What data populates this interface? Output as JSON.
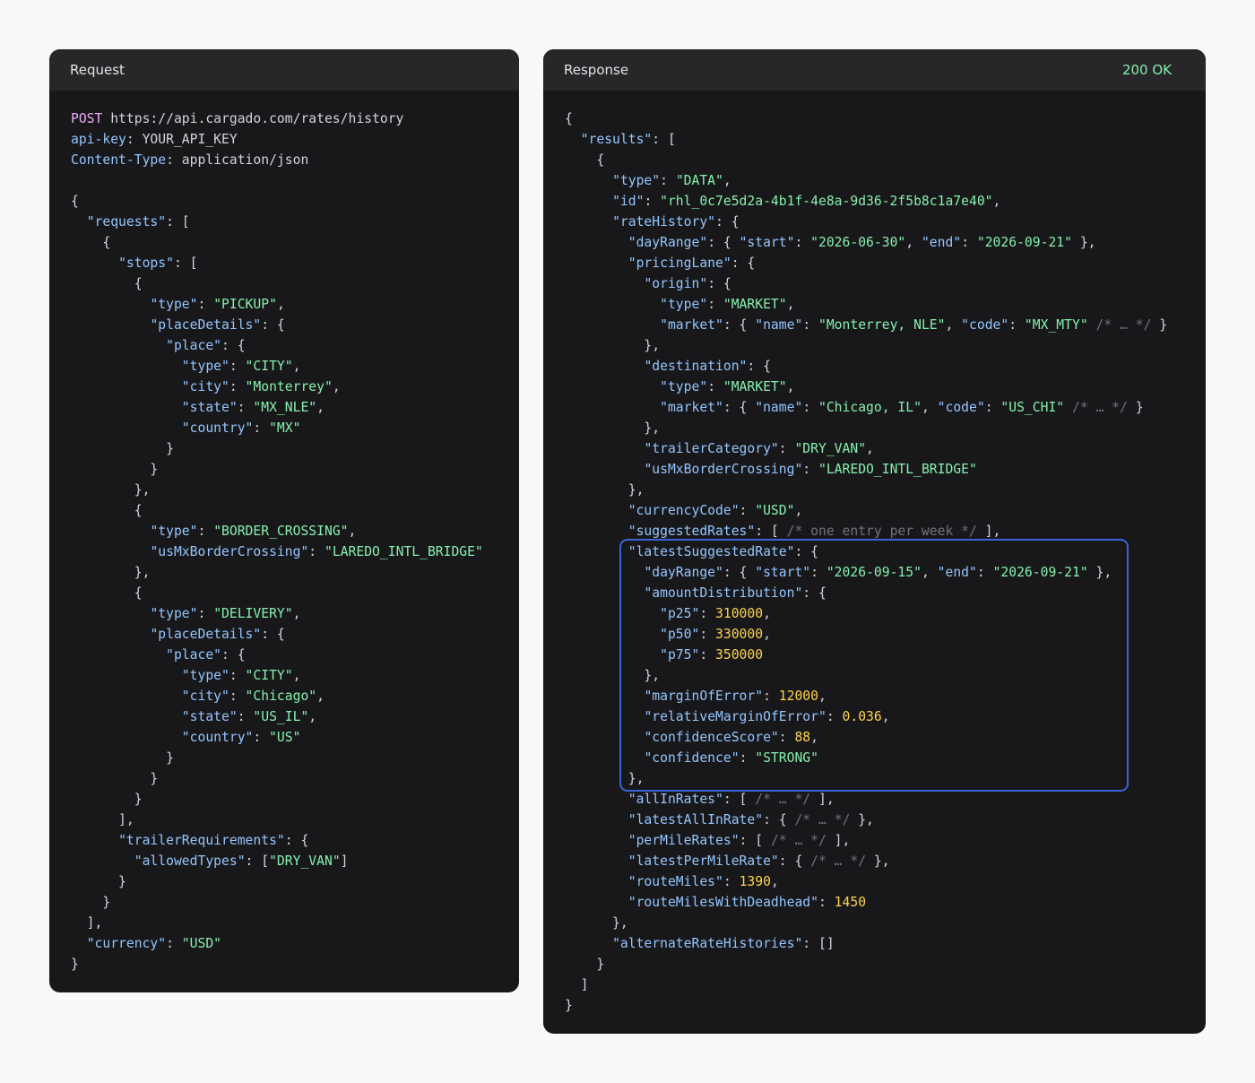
{
  "request_panel": {
    "title": "Request",
    "lines": [
      [
        [
          "m",
          "POST"
        ],
        [
          "p",
          " https://api.cargado.com/rates/history"
        ]
      ],
      [
        [
          "k",
          "api-key"
        ],
        [
          "p",
          ": YOUR_API_KEY"
        ]
      ],
      [
        [
          "k",
          "Content-Type"
        ],
        [
          "p",
          ": application/json"
        ]
      ],
      [],
      [
        [
          "p",
          "{"
        ]
      ],
      [
        [
          "p",
          "  "
        ],
        [
          "k",
          "\"requests\""
        ],
        [
          "p",
          ": ["
        ]
      ],
      [
        [
          "p",
          "    {"
        ]
      ],
      [
        [
          "p",
          "      "
        ],
        [
          "k",
          "\"stops\""
        ],
        [
          "p",
          ": ["
        ]
      ],
      [
        [
          "p",
          "        {"
        ]
      ],
      [
        [
          "p",
          "          "
        ],
        [
          "k",
          "\"type\""
        ],
        [
          "p",
          ": "
        ],
        [
          "s",
          "\"PICKUP\""
        ],
        [
          "p",
          ","
        ]
      ],
      [
        [
          "p",
          "          "
        ],
        [
          "k",
          "\"placeDetails\""
        ],
        [
          "p",
          ": {"
        ]
      ],
      [
        [
          "p",
          "            "
        ],
        [
          "k",
          "\"place\""
        ],
        [
          "p",
          ": {"
        ]
      ],
      [
        [
          "p",
          "              "
        ],
        [
          "k",
          "\"type\""
        ],
        [
          "p",
          ": "
        ],
        [
          "s",
          "\"CITY\""
        ],
        [
          "p",
          ","
        ]
      ],
      [
        [
          "p",
          "              "
        ],
        [
          "k",
          "\"city\""
        ],
        [
          "p",
          ": "
        ],
        [
          "s",
          "\"Monterrey\""
        ],
        [
          "p",
          ","
        ]
      ],
      [
        [
          "p",
          "              "
        ],
        [
          "k",
          "\"state\""
        ],
        [
          "p",
          ": "
        ],
        [
          "s",
          "\"MX_NLE\""
        ],
        [
          "p",
          ","
        ]
      ],
      [
        [
          "p",
          "              "
        ],
        [
          "k",
          "\"country\""
        ],
        [
          "p",
          ": "
        ],
        [
          "s",
          "\"MX\""
        ]
      ],
      [
        [
          "p",
          "            }"
        ]
      ],
      [
        [
          "p",
          "          }"
        ]
      ],
      [
        [
          "p",
          "        },"
        ]
      ],
      [
        [
          "p",
          "        {"
        ]
      ],
      [
        [
          "p",
          "          "
        ],
        [
          "k",
          "\"type\""
        ],
        [
          "p",
          ": "
        ],
        [
          "s",
          "\"BORDER_CROSSING\""
        ],
        [
          "p",
          ","
        ]
      ],
      [
        [
          "p",
          "          "
        ],
        [
          "k",
          "\"usMxBorderCrossing\""
        ],
        [
          "p",
          ": "
        ],
        [
          "s",
          "\"LAREDO_INTL_BRIDGE\""
        ]
      ],
      [
        [
          "p",
          "        },"
        ]
      ],
      [
        [
          "p",
          "        {"
        ]
      ],
      [
        [
          "p",
          "          "
        ],
        [
          "k",
          "\"type\""
        ],
        [
          "p",
          ": "
        ],
        [
          "s",
          "\"DELIVERY\""
        ],
        [
          "p",
          ","
        ]
      ],
      [
        [
          "p",
          "          "
        ],
        [
          "k",
          "\"placeDetails\""
        ],
        [
          "p",
          ": {"
        ]
      ],
      [
        [
          "p",
          "            "
        ],
        [
          "k",
          "\"place\""
        ],
        [
          "p",
          ": {"
        ]
      ],
      [
        [
          "p",
          "              "
        ],
        [
          "k",
          "\"type\""
        ],
        [
          "p",
          ": "
        ],
        [
          "s",
          "\"CITY\""
        ],
        [
          "p",
          ","
        ]
      ],
      [
        [
          "p",
          "              "
        ],
        [
          "k",
          "\"city\""
        ],
        [
          "p",
          ": "
        ],
        [
          "s",
          "\"Chicago\""
        ],
        [
          "p",
          ","
        ]
      ],
      [
        [
          "p",
          "              "
        ],
        [
          "k",
          "\"state\""
        ],
        [
          "p",
          ": "
        ],
        [
          "s",
          "\"US_IL\""
        ],
        [
          "p",
          ","
        ]
      ],
      [
        [
          "p",
          "              "
        ],
        [
          "k",
          "\"country\""
        ],
        [
          "p",
          ": "
        ],
        [
          "s",
          "\"US\""
        ]
      ],
      [
        [
          "p",
          "            }"
        ]
      ],
      [
        [
          "p",
          "          }"
        ]
      ],
      [
        [
          "p",
          "        }"
        ]
      ],
      [
        [
          "p",
          "      ],"
        ]
      ],
      [
        [
          "p",
          "      "
        ],
        [
          "k",
          "\"trailerRequirements\""
        ],
        [
          "p",
          ": {"
        ]
      ],
      [
        [
          "p",
          "        "
        ],
        [
          "k",
          "\"allowedTypes\""
        ],
        [
          "p",
          ": ["
        ],
        [
          "s",
          "\"DRY_VAN\""
        ],
        [
          "p",
          "]"
        ]
      ],
      [
        [
          "p",
          "      }"
        ]
      ],
      [
        [
          "p",
          "    }"
        ]
      ],
      [
        [
          "p",
          "  ],"
        ]
      ],
      [
        [
          "p",
          "  "
        ],
        [
          "k",
          "\"currency\""
        ],
        [
          "p",
          ": "
        ],
        [
          "s",
          "\"USD\""
        ]
      ],
      [
        [
          "p",
          "}"
        ]
      ]
    ]
  },
  "response_panel": {
    "title": "Response",
    "status": "200 OK",
    "lines": [
      [
        [
          "p",
          "{"
        ]
      ],
      [
        [
          "p",
          "  "
        ],
        [
          "k",
          "\"results\""
        ],
        [
          "p",
          ": ["
        ]
      ],
      [
        [
          "p",
          "    {"
        ]
      ],
      [
        [
          "p",
          "      "
        ],
        [
          "k",
          "\"type\""
        ],
        [
          "p",
          ": "
        ],
        [
          "s",
          "\"DATA\""
        ],
        [
          "p",
          ","
        ]
      ],
      [
        [
          "p",
          "      "
        ],
        [
          "k",
          "\"id\""
        ],
        [
          "p",
          ": "
        ],
        [
          "s",
          "\"rhl_0c7e5d2a-4b1f-4e8a-9d36-2f5b8c1a7e40\""
        ],
        [
          "p",
          ","
        ]
      ],
      [
        [
          "p",
          "      "
        ],
        [
          "k",
          "\"rateHistory\""
        ],
        [
          "p",
          ": {"
        ]
      ],
      [
        [
          "p",
          "        "
        ],
        [
          "k",
          "\"dayRange\""
        ],
        [
          "p",
          ": { "
        ],
        [
          "k",
          "\"start\""
        ],
        [
          "p",
          ": "
        ],
        [
          "s",
          "\"2026-06-30\""
        ],
        [
          "p",
          ", "
        ],
        [
          "k",
          "\"end\""
        ],
        [
          "p",
          ": "
        ],
        [
          "s",
          "\"2026-09-21\""
        ],
        [
          "p",
          " },"
        ]
      ],
      [
        [
          "p",
          "        "
        ],
        [
          "k",
          "\"pricingLane\""
        ],
        [
          "p",
          ": {"
        ]
      ],
      [
        [
          "p",
          "          "
        ],
        [
          "k",
          "\"origin\""
        ],
        [
          "p",
          ": {"
        ]
      ],
      [
        [
          "p",
          "            "
        ],
        [
          "k",
          "\"type\""
        ],
        [
          "p",
          ": "
        ],
        [
          "s",
          "\"MARKET\""
        ],
        [
          "p",
          ","
        ]
      ],
      [
        [
          "p",
          "            "
        ],
        [
          "k",
          "\"market\""
        ],
        [
          "p",
          ": { "
        ],
        [
          "k",
          "\"name\""
        ],
        [
          "p",
          ": "
        ],
        [
          "s",
          "\"Monterrey, NLE\""
        ],
        [
          "p",
          ", "
        ],
        [
          "k",
          "\"code\""
        ],
        [
          "p",
          ": "
        ],
        [
          "s",
          "\"MX_MTY\""
        ],
        [
          "p",
          " "
        ],
        [
          "c",
          "/* … */"
        ],
        [
          "p",
          " }"
        ]
      ],
      [
        [
          "p",
          "          },"
        ]
      ],
      [
        [
          "p",
          "          "
        ],
        [
          "k",
          "\"destination\""
        ],
        [
          "p",
          ": {"
        ]
      ],
      [
        [
          "p",
          "            "
        ],
        [
          "k",
          "\"type\""
        ],
        [
          "p",
          ": "
        ],
        [
          "s",
          "\"MARKET\""
        ],
        [
          "p",
          ","
        ]
      ],
      [
        [
          "p",
          "            "
        ],
        [
          "k",
          "\"market\""
        ],
        [
          "p",
          ": { "
        ],
        [
          "k",
          "\"name\""
        ],
        [
          "p",
          ": "
        ],
        [
          "s",
          "\"Chicago, IL\""
        ],
        [
          "p",
          ", "
        ],
        [
          "k",
          "\"code\""
        ],
        [
          "p",
          ": "
        ],
        [
          "s",
          "\"US_CHI\""
        ],
        [
          "p",
          " "
        ],
        [
          "c",
          "/* … */"
        ],
        [
          "p",
          " }"
        ]
      ],
      [
        [
          "p",
          "          },"
        ]
      ],
      [
        [
          "p",
          "          "
        ],
        [
          "k",
          "\"trailerCategory\""
        ],
        [
          "p",
          ": "
        ],
        [
          "s",
          "\"DRY_VAN\""
        ],
        [
          "p",
          ","
        ]
      ],
      [
        [
          "p",
          "          "
        ],
        [
          "k",
          "\"usMxBorderCrossing\""
        ],
        [
          "p",
          ": "
        ],
        [
          "s",
          "\"LAREDO_INTL_BRIDGE\""
        ]
      ],
      [
        [
          "p",
          "        },"
        ]
      ],
      [
        [
          "p",
          "        "
        ],
        [
          "k",
          "\"currencyCode\""
        ],
        [
          "p",
          ": "
        ],
        [
          "s",
          "\"USD\""
        ],
        [
          "p",
          ","
        ]
      ],
      [
        [
          "p",
          "        "
        ],
        [
          "k",
          "\"suggestedRates\""
        ],
        [
          "p",
          ": [ "
        ],
        [
          "c",
          "/* one entry per week */"
        ],
        [
          "p",
          " ],"
        ]
      ],
      [
        [
          "p",
          "        "
        ],
        [
          "k",
          "\"latestSuggestedRate\""
        ],
        [
          "p",
          ": {"
        ]
      ],
      [
        [
          "p",
          "          "
        ],
        [
          "k",
          "\"dayRange\""
        ],
        [
          "p",
          ": { "
        ],
        [
          "k",
          "\"start\""
        ],
        [
          "p",
          ": "
        ],
        [
          "s",
          "\"2026-09-15\""
        ],
        [
          "p",
          ", "
        ],
        [
          "k",
          "\"end\""
        ],
        [
          "p",
          ": "
        ],
        [
          "s",
          "\"2026-09-21\""
        ],
        [
          "p",
          " },"
        ]
      ],
      [
        [
          "p",
          "          "
        ],
        [
          "k",
          "\"amountDistribution\""
        ],
        [
          "p",
          ": {"
        ]
      ],
      [
        [
          "p",
          "            "
        ],
        [
          "k",
          "\"p25\""
        ],
        [
          "p",
          ": "
        ],
        [
          "n",
          "310000"
        ],
        [
          "p",
          ","
        ]
      ],
      [
        [
          "p",
          "            "
        ],
        [
          "k",
          "\"p50\""
        ],
        [
          "p",
          ": "
        ],
        [
          "n",
          "330000"
        ],
        [
          "p",
          ","
        ]
      ],
      [
        [
          "p",
          "            "
        ],
        [
          "k",
          "\"p75\""
        ],
        [
          "p",
          ": "
        ],
        [
          "n",
          "350000"
        ]
      ],
      [
        [
          "p",
          "          },"
        ]
      ],
      [
        [
          "p",
          "          "
        ],
        [
          "k",
          "\"marginOfError\""
        ],
        [
          "p",
          ": "
        ],
        [
          "n",
          "12000"
        ],
        [
          "p",
          ","
        ]
      ],
      [
        [
          "p",
          "          "
        ],
        [
          "k",
          "\"relativeMarginOfError\""
        ],
        [
          "p",
          ": "
        ],
        [
          "n",
          "0.036"
        ],
        [
          "p",
          ","
        ]
      ],
      [
        [
          "p",
          "          "
        ],
        [
          "k",
          "\"confidenceScore\""
        ],
        [
          "p",
          ": "
        ],
        [
          "n",
          "88"
        ],
        [
          "p",
          ","
        ]
      ],
      [
        [
          "p",
          "          "
        ],
        [
          "k",
          "\"confidence\""
        ],
        [
          "p",
          ": "
        ],
        [
          "s",
          "\"STRONG\""
        ]
      ],
      [
        [
          "p",
          "        },"
        ]
      ],
      [
        [
          "p",
          "        "
        ],
        [
          "k",
          "\"allInRates\""
        ],
        [
          "p",
          ": [ "
        ],
        [
          "c",
          "/* … */"
        ],
        [
          "p",
          " ],"
        ]
      ],
      [
        [
          "p",
          "        "
        ],
        [
          "k",
          "\"latestAllInRate\""
        ],
        [
          "p",
          ": { "
        ],
        [
          "c",
          "/* … */"
        ],
        [
          "p",
          " },"
        ]
      ],
      [
        [
          "p",
          "        "
        ],
        [
          "k",
          "\"perMileRates\""
        ],
        [
          "p",
          ": [ "
        ],
        [
          "c",
          "/* … */"
        ],
        [
          "p",
          " ],"
        ]
      ],
      [
        [
          "p",
          "        "
        ],
        [
          "k",
          "\"latestPerMileRate\""
        ],
        [
          "p",
          ": { "
        ],
        [
          "c",
          "/* … */"
        ],
        [
          "p",
          " },"
        ]
      ],
      [
        [
          "p",
          "        "
        ],
        [
          "k",
          "\"routeMiles\""
        ],
        [
          "p",
          ": "
        ],
        [
          "n",
          "1390"
        ],
        [
          "p",
          ","
        ]
      ],
      [
        [
          "p",
          "        "
        ],
        [
          "k",
          "\"routeMilesWithDeadhead\""
        ],
        [
          "p",
          ": "
        ],
        [
          "n",
          "1450"
        ]
      ],
      [
        [
          "p",
          "      },"
        ]
      ],
      [
        [
          "p",
          "      "
        ],
        [
          "k",
          "\"alternateRateHistories\""
        ],
        [
          "p",
          ": []"
        ]
      ],
      [
        [
          "p",
          "    }"
        ]
      ],
      [
        [
          "p",
          "  ]"
        ]
      ],
      [
        [
          "p",
          "}"
        ]
      ]
    ]
  }
}
